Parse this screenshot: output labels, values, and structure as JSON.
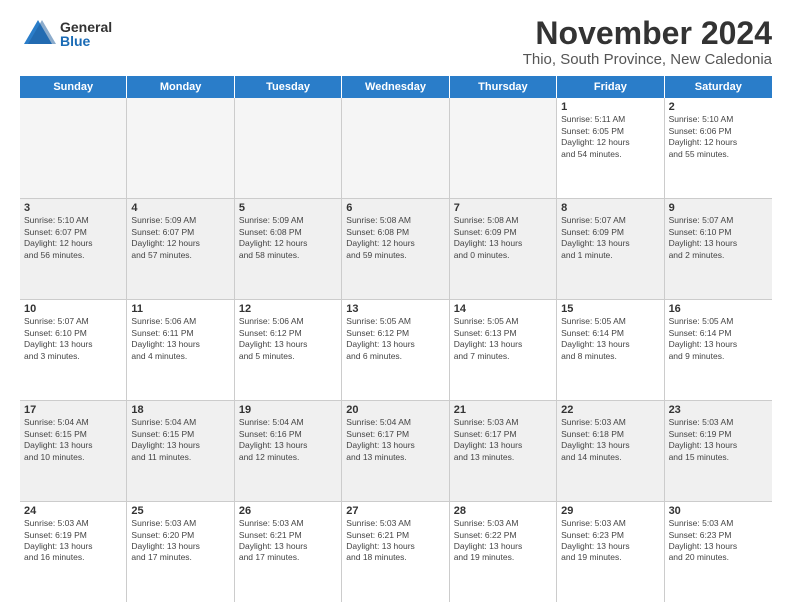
{
  "logo": {
    "general": "General",
    "blue": "Blue"
  },
  "title": "November 2024",
  "location": "Thio, South Province, New Caledonia",
  "header_days": [
    "Sunday",
    "Monday",
    "Tuesday",
    "Wednesday",
    "Thursday",
    "Friday",
    "Saturday"
  ],
  "weeks": [
    [
      {
        "day": "",
        "empty": true
      },
      {
        "day": "",
        "empty": true
      },
      {
        "day": "",
        "empty": true
      },
      {
        "day": "",
        "empty": true
      },
      {
        "day": "",
        "empty": true
      },
      {
        "day": "1",
        "info": "Sunrise: 5:11 AM\nSunset: 6:05 PM\nDaylight: 12 hours\nand 54 minutes."
      },
      {
        "day": "2",
        "info": "Sunrise: 5:10 AM\nSunset: 6:06 PM\nDaylight: 12 hours\nand 55 minutes."
      }
    ],
    [
      {
        "day": "3",
        "info": "Sunrise: 5:10 AM\nSunset: 6:07 PM\nDaylight: 12 hours\nand 56 minutes."
      },
      {
        "day": "4",
        "info": "Sunrise: 5:09 AM\nSunset: 6:07 PM\nDaylight: 12 hours\nand 57 minutes."
      },
      {
        "day": "5",
        "info": "Sunrise: 5:09 AM\nSunset: 6:08 PM\nDaylight: 12 hours\nand 58 minutes."
      },
      {
        "day": "6",
        "info": "Sunrise: 5:08 AM\nSunset: 6:08 PM\nDaylight: 12 hours\nand 59 minutes."
      },
      {
        "day": "7",
        "info": "Sunrise: 5:08 AM\nSunset: 6:09 PM\nDaylight: 13 hours\nand 0 minutes."
      },
      {
        "day": "8",
        "info": "Sunrise: 5:07 AM\nSunset: 6:09 PM\nDaylight: 13 hours\nand 1 minute."
      },
      {
        "day": "9",
        "info": "Sunrise: 5:07 AM\nSunset: 6:10 PM\nDaylight: 13 hours\nand 2 minutes."
      }
    ],
    [
      {
        "day": "10",
        "info": "Sunrise: 5:07 AM\nSunset: 6:10 PM\nDaylight: 13 hours\nand 3 minutes."
      },
      {
        "day": "11",
        "info": "Sunrise: 5:06 AM\nSunset: 6:11 PM\nDaylight: 13 hours\nand 4 minutes."
      },
      {
        "day": "12",
        "info": "Sunrise: 5:06 AM\nSunset: 6:12 PM\nDaylight: 13 hours\nand 5 minutes."
      },
      {
        "day": "13",
        "info": "Sunrise: 5:05 AM\nSunset: 6:12 PM\nDaylight: 13 hours\nand 6 minutes."
      },
      {
        "day": "14",
        "info": "Sunrise: 5:05 AM\nSunset: 6:13 PM\nDaylight: 13 hours\nand 7 minutes."
      },
      {
        "day": "15",
        "info": "Sunrise: 5:05 AM\nSunset: 6:14 PM\nDaylight: 13 hours\nand 8 minutes."
      },
      {
        "day": "16",
        "info": "Sunrise: 5:05 AM\nSunset: 6:14 PM\nDaylight: 13 hours\nand 9 minutes."
      }
    ],
    [
      {
        "day": "17",
        "info": "Sunrise: 5:04 AM\nSunset: 6:15 PM\nDaylight: 13 hours\nand 10 minutes."
      },
      {
        "day": "18",
        "info": "Sunrise: 5:04 AM\nSunset: 6:15 PM\nDaylight: 13 hours\nand 11 minutes."
      },
      {
        "day": "19",
        "info": "Sunrise: 5:04 AM\nSunset: 6:16 PM\nDaylight: 13 hours\nand 12 minutes."
      },
      {
        "day": "20",
        "info": "Sunrise: 5:04 AM\nSunset: 6:17 PM\nDaylight: 13 hours\nand 13 minutes."
      },
      {
        "day": "21",
        "info": "Sunrise: 5:03 AM\nSunset: 6:17 PM\nDaylight: 13 hours\nand 13 minutes."
      },
      {
        "day": "22",
        "info": "Sunrise: 5:03 AM\nSunset: 6:18 PM\nDaylight: 13 hours\nand 14 minutes."
      },
      {
        "day": "23",
        "info": "Sunrise: 5:03 AM\nSunset: 6:19 PM\nDaylight: 13 hours\nand 15 minutes."
      }
    ],
    [
      {
        "day": "24",
        "info": "Sunrise: 5:03 AM\nSunset: 6:19 PM\nDaylight: 13 hours\nand 16 minutes."
      },
      {
        "day": "25",
        "info": "Sunrise: 5:03 AM\nSunset: 6:20 PM\nDaylight: 13 hours\nand 17 minutes."
      },
      {
        "day": "26",
        "info": "Sunrise: 5:03 AM\nSunset: 6:21 PM\nDaylight: 13 hours\nand 17 minutes."
      },
      {
        "day": "27",
        "info": "Sunrise: 5:03 AM\nSunset: 6:21 PM\nDaylight: 13 hours\nand 18 minutes."
      },
      {
        "day": "28",
        "info": "Sunrise: 5:03 AM\nSunset: 6:22 PM\nDaylight: 13 hours\nand 19 minutes."
      },
      {
        "day": "29",
        "info": "Sunrise: 5:03 AM\nSunset: 6:23 PM\nDaylight: 13 hours\nand 19 minutes."
      },
      {
        "day": "30",
        "info": "Sunrise: 5:03 AM\nSunset: 6:23 PM\nDaylight: 13 hours\nand 20 minutes."
      }
    ]
  ]
}
